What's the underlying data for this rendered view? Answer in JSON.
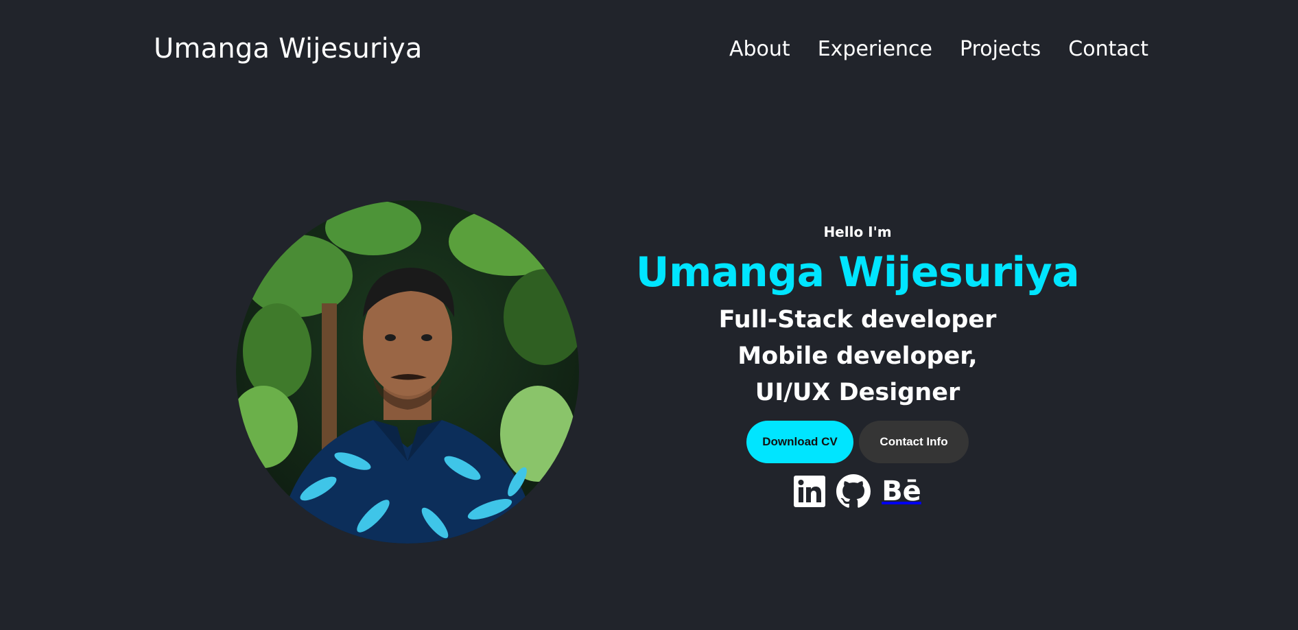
{
  "header": {
    "logo": "Umanga Wijesuriya",
    "nav": [
      "About",
      "Experience",
      "Projects",
      "Contact"
    ]
  },
  "hero": {
    "greeting": "Hello I'm",
    "name": "Umanga Wijesuriya",
    "roles": [
      "Full-Stack developer",
      "Mobile developer,",
      "UI/UX Designer"
    ],
    "buttons": {
      "download_cv": "Download CV",
      "contact_info": "Contact Info"
    },
    "socials": [
      "linkedin-icon",
      "github-icon",
      "behance-icon"
    ],
    "behance_label": "Bē"
  },
  "colors": {
    "background": "#21242b",
    "accent": "#00e5ff",
    "secondary_button": "#353535"
  }
}
